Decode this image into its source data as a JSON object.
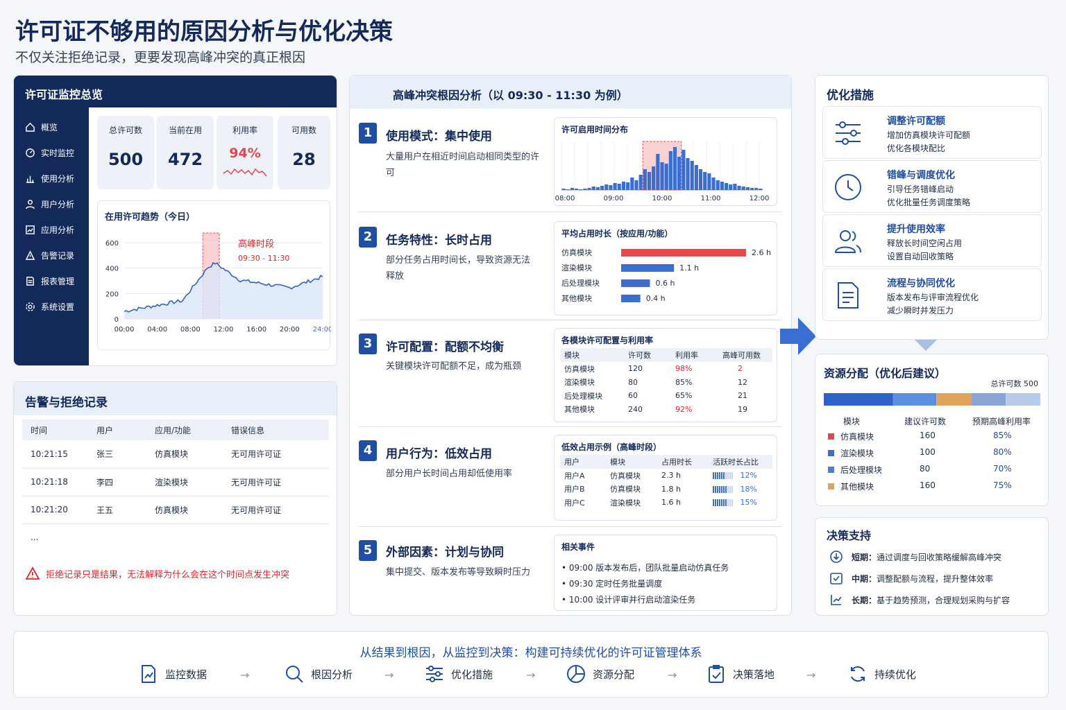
{
  "header": {
    "title": "许可证不够用的原因分析与优化决策",
    "subtitle": "不仅关注拒绝记录，更要发现高峰冲突的真正根因"
  },
  "overview": {
    "title": "许可证监控总览",
    "nav": [
      {
        "label": "概览",
        "icon": "home-icon"
      },
      {
        "label": "实时监控",
        "icon": "monitor-icon"
      },
      {
        "label": "使用分析",
        "icon": "bar-chart-icon"
      },
      {
        "label": "用户分析",
        "icon": "user-icon"
      },
      {
        "label": "应用分析",
        "icon": "app-chart-icon"
      },
      {
        "label": "告警记录",
        "icon": "alert-icon"
      },
      {
        "label": "报表管理",
        "icon": "report-icon"
      },
      {
        "label": "系统设置",
        "icon": "gear-icon"
      }
    ],
    "stats": [
      {
        "label": "总许可数",
        "value": "500"
      },
      {
        "label": "当前在用",
        "value": "472"
      },
      {
        "label": "利用率",
        "value": "94%"
      },
      {
        "label": "可用数",
        "value": "28"
      }
    ],
    "trend": {
      "title": "在用许可趋势（今日）",
      "peak_label": "高峰时段",
      "peak_range": "09:30 - 11:30",
      "yticks": [
        "600",
        "400",
        "200",
        "0"
      ],
      "xticks": [
        "00:00",
        "04:00",
        "08:00",
        "12:00",
        "16:00",
        "20:00",
        "24:00"
      ]
    }
  },
  "alerts": {
    "title": "告警与拒绝记录",
    "columns": [
      "时间",
      "用户",
      "应用/功能",
      "错误信息"
    ],
    "rows": [
      [
        "10:21:15",
        "张三",
        "仿真模块",
        "无可用许可证"
      ],
      [
        "10:21:18",
        "李四",
        "渲染模块",
        "无可用许可证"
      ],
      [
        "10:21:20",
        "王五",
        "仿真模块",
        "无可用许可证"
      ]
    ],
    "more": "...",
    "warning": "拒绝记录只是结果，无法解释为什么会在这个时间点发生冲突"
  },
  "analysis": {
    "title": "高峰冲突根因分析（以 09:30 - 11:30 为例）",
    "causes": [
      {
        "num": "1",
        "title": "使用模式：集中使用",
        "desc": "大量用户在相近时间启动相同类型的许可"
      },
      {
        "num": "2",
        "title": "任务特性：长时占用",
        "desc": "部分任务占用时间长，导致资源无法释放"
      },
      {
        "num": "3",
        "title": "许可配置：配额不均衡",
        "desc": "关键模块许可配额不足，成为瓶颈"
      },
      {
        "num": "4",
        "title": "用户行为：低效占用",
        "desc": "部分用户长时间占用却低使用率"
      },
      {
        "num": "5",
        "title": "外部因素：计划与协同",
        "desc": "集中提交、版本发布等导致瞬时压力"
      }
    ],
    "histogram": {
      "title": "许可启用时间分布",
      "xticks": [
        "08:00",
        "09:00",
        "10:00",
        "11:00",
        "12:00"
      ]
    },
    "duration": {
      "title": "平均占用时长（按应用/功能）",
      "rows": [
        {
          "name": "仿真模块",
          "value": 2.6,
          "label": "2.6 h",
          "color": "#e8474c"
        },
        {
          "name": "渲染模块",
          "value": 1.1,
          "label": "1.1 h",
          "color": "#3a6fd1"
        },
        {
          "name": "后处理模块",
          "value": 0.6,
          "label": "0.6 h",
          "color": "#3a6fd1"
        },
        {
          "name": "其他模块",
          "value": 0.4,
          "label": "0.4 h",
          "color": "#3a6fd1"
        }
      ]
    },
    "config": {
      "title": "各模块许可配置与利用率",
      "columns": [
        "模块",
        "许可数",
        "利用率",
        "高峰可用数"
      ],
      "rows": [
        [
          "仿真模块",
          "120",
          "98%",
          "2"
        ],
        [
          "渲染模块",
          "80",
          "85%",
          "12"
        ],
        [
          "后处理模块",
          "60",
          "65%",
          "21"
        ],
        [
          "其他模块",
          "240",
          "92%",
          "19"
        ]
      ]
    },
    "low_eff": {
      "title": "低效占用示例（高峰时段）",
      "columns": [
        "用户",
        "模块",
        "占用时长",
        "活跃时长占比"
      ],
      "rows": [
        {
          "user": "用户A",
          "module": "仿真模块",
          "dur": "2.3 h",
          "ratio": "12%",
          "ratio_value": 12
        },
        {
          "user": "用户B",
          "module": "仿真模块",
          "dur": "1.8 h",
          "ratio": "18%",
          "ratio_value": 18
        },
        {
          "user": "用户C",
          "module": "渲染模块",
          "dur": "1.6 h",
          "ratio": "15%",
          "ratio_value": 15
        }
      ]
    },
    "events": {
      "title": "相关事件",
      "items": [
        "09:00 版本发布后，团队批量启动仿真任务",
        "09:30 定时任务批量调度",
        "10:00 设计评审并行启动渲染任务"
      ]
    }
  },
  "optimize": {
    "title": "优化措施",
    "items": [
      {
        "title": "调整许可配额",
        "lines": [
          "增加仿真模块许可配额",
          "优化各模块配比"
        ],
        "icon": "sliders-icon"
      },
      {
        "title": "错峰与调度优化",
        "lines": [
          "引导任务错峰启动",
          "优化批量任务调度策略"
        ],
        "icon": "clock-icon"
      },
      {
        "title": "提升使用效率",
        "lines": [
          "释放长时间空闲占用",
          "设置自动回收策略"
        ],
        "icon": "users-icon"
      },
      {
        "title": "流程与协同优化",
        "lines": [
          "版本发布与评审流程优化",
          "减少瞬时并发压力"
        ],
        "icon": "document-icon"
      }
    ]
  },
  "allocation": {
    "title": "资源分配（优化后建议）",
    "total": "总许可数 500",
    "columns": [
      "模块",
      "建议许可数",
      "预期高峰利用率"
    ],
    "rows": [
      {
        "name": "仿真模块",
        "count": "160",
        "util": "85%",
        "color": "#e0474c"
      },
      {
        "name": "渲染模块",
        "count": "100",
        "util": "80%",
        "color": "#3a6fd1"
      },
      {
        "name": "后处理模块",
        "count": "80",
        "util": "70%",
        "color": "#4a7fd8"
      },
      {
        "name": "其他模块",
        "count": "160",
        "util": "75%",
        "color": "#e0a35b"
      }
    ],
    "bar_segments": [
      {
        "value": 160,
        "color": "#2f62c8"
      },
      {
        "value": 100,
        "color": "#5a8fe0"
      },
      {
        "value": 80,
        "color": "#e0a35b"
      },
      {
        "value": 80,
        "color": "#8aa6d6"
      },
      {
        "value": 80,
        "color": "#b9cbea"
      }
    ]
  },
  "decision": {
    "title": "决策支持",
    "items": [
      {
        "label": "短期：",
        "text": "通过调度与回收策略缓解高峰冲突"
      },
      {
        "label": "中期：",
        "text": "调整配额与流程，提升整体效率"
      },
      {
        "label": "长期：",
        "text": "基于趋势预测，合理规划采购与扩容"
      }
    ]
  },
  "footer": {
    "slogan": "从结果到根因，从监控到决策：构建可持续优化的许可证管理体系",
    "steps": [
      "监控数据",
      "根因分析",
      "优化措施",
      "资源分配",
      "决策落地",
      "持续优化"
    ]
  }
}
